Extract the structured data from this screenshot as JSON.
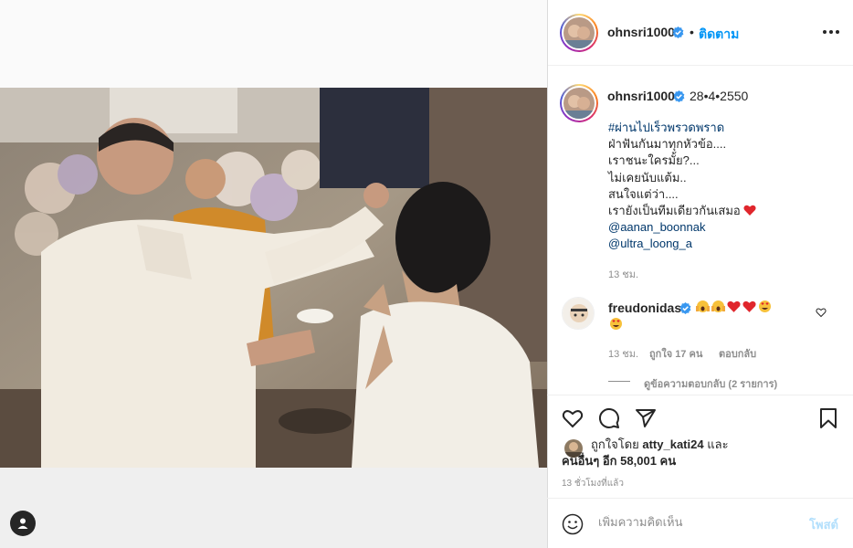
{
  "post": {
    "username": "ohnsri1000",
    "follow_label": "ติดตาม",
    "dot": "•",
    "date": "28•4•2550",
    "caption": {
      "hashtag": "#ผ่านไปเร็วพรวดพราด",
      "lines": [
        "ฝ่าฟันกันมาทุกหัวข้อ....",
        "เราชนะใครมั้ย?...",
        "ไม่เคยนับแต้ม..",
        "สนใจแต่ว่า....",
        "เรายังเป็นทีมเดียวกันเสมอ"
      ],
      "mentions": [
        "@aanan_boonnak",
        "@ultra_loong_a"
      ]
    },
    "caption_time": "13 ชม."
  },
  "comment": {
    "username": "freudonidas",
    "time": "13 ชม.",
    "likes": "ถูกใจ 17 คน",
    "reply_label": "ตอบกลับ",
    "view_replies": "ดูข้อความตอบกลับ (2 รายการ)"
  },
  "actions": {
    "liked_by_prefix": "ถูกใจโดย",
    "liked_by_user": "atty_kati24",
    "liked_by_and": "และ",
    "liked_by_others": "คนอื่นๆ อีก 58,001 คน",
    "time_ago": "13 ชั่วโมงที่แล้ว",
    "comment_placeholder": "เพิ่มความคิดเห็น",
    "post_label": "โพสต์"
  },
  "colors": {
    "link": "#00376b",
    "follow": "#0095f6",
    "verified": "#3897f0",
    "heart": "#ed4956",
    "post_disabled": "#b2dffc"
  },
  "icons": [
    "verified-badge-icon",
    "more-options-icon",
    "heart-icon",
    "comment-icon",
    "share-icon",
    "bookmark-icon",
    "emoji-icon",
    "tag-user-icon"
  ]
}
